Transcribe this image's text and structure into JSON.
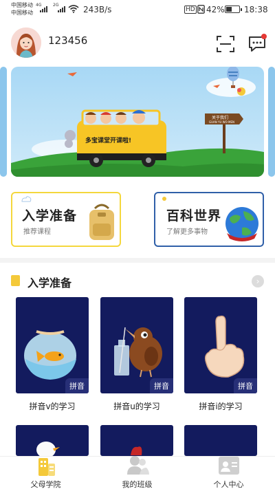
{
  "status_bar": {
    "carrier_1": "中国移动",
    "carrier_2": "中国移动",
    "net_1": "4G",
    "net_2": "2G",
    "speed": "243B/s",
    "hd": "HD",
    "battery": "42%",
    "time": "18:38"
  },
  "header": {
    "username": "123456"
  },
  "banner": {
    "bus_text": "多宝课堂开课啦!",
    "sign_title": "关于我们",
    "sign_pinyin": "GUAN YU WO MEN"
  },
  "entries": [
    {
      "title": "入学准备",
      "subtitle": "推荐课程"
    },
    {
      "title": "百科世界",
      "subtitle": "了解更多事物"
    }
  ],
  "section": {
    "title": "入学准备",
    "more_icon": "chevron-right-icon"
  },
  "courses": [
    {
      "name": "拼音v的学习",
      "tag": "拼音"
    },
    {
      "name": "拼音u的学习",
      "tag": "拼音"
    },
    {
      "name": "拼音i的学习",
      "tag": "拼音"
    }
  ],
  "tabs": [
    {
      "label": "父母学院",
      "icon": "school-icon"
    },
    {
      "label": "我的班级",
      "icon": "class-icon"
    },
    {
      "label": "个人中心",
      "icon": "profile-card-icon"
    }
  ],
  "colors": {
    "entry_left_border": "#f4d73c",
    "entry_right_border": "#2f5fa8",
    "course_bg": "#131b5e",
    "accent_yellow": "#f4c93a",
    "badge_red": "#e53935"
  }
}
